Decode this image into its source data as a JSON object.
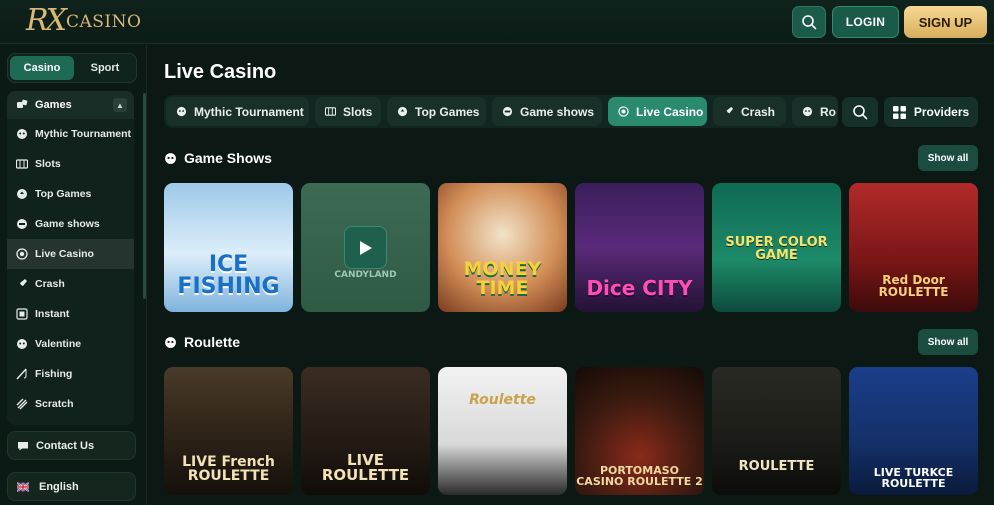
{
  "header": {
    "logo_mark": "RX",
    "logo_text": "CASINO",
    "login_label": "LOGIN",
    "signup_label": "SIGN UP"
  },
  "sidebar": {
    "segments": [
      "Casino",
      "Sport"
    ],
    "games_label": "Games",
    "items": [
      {
        "label": "Mythic Tournament",
        "icon": "tournament-icon"
      },
      {
        "label": "Slots",
        "icon": "slots-icon"
      },
      {
        "label": "Top Games",
        "icon": "top-games-icon"
      },
      {
        "label": "Game shows",
        "icon": "game-shows-icon"
      },
      {
        "label": "Live Casino",
        "icon": "live-casino-icon"
      },
      {
        "label": "Crash",
        "icon": "crash-icon"
      },
      {
        "label": "Instant",
        "icon": "instant-icon"
      },
      {
        "label": "Valentine",
        "icon": "valentine-icon"
      },
      {
        "label": "Fishing",
        "icon": "fishing-icon"
      },
      {
        "label": "Scratch",
        "icon": "scratch-icon"
      }
    ],
    "contact_label": "Contact Us",
    "language_label": "English"
  },
  "main": {
    "title": "Live Casino",
    "tabs": [
      "Mythic Tournament",
      "Slots",
      "Top Games",
      "Game shows",
      "Live Casino",
      "Crash",
      "Ro"
    ],
    "providers_label": "Providers",
    "sections": [
      {
        "title": "Game Shows",
        "show_all": "Show all",
        "games": [
          "ICE FISHING",
          "CANDYLAND",
          "MONEY TIME",
          "Dice CITY",
          "SUPER COLOR GAME",
          "Red Door ROULETTE"
        ]
      },
      {
        "title": "Roulette",
        "show_all": "Show all",
        "games": [
          "LIVE French ROULETTE",
          "LIVE ROULETTE",
          "Roulette",
          "PORTOMASO CASINO ROULETTE 2",
          "ROULETTE",
          "LIVE TURKCE ROULETTE"
        ]
      }
    ]
  },
  "colors": {
    "accent": "#2a8a6e",
    "gold": "#e8c47a",
    "background": "#0b1814"
  }
}
